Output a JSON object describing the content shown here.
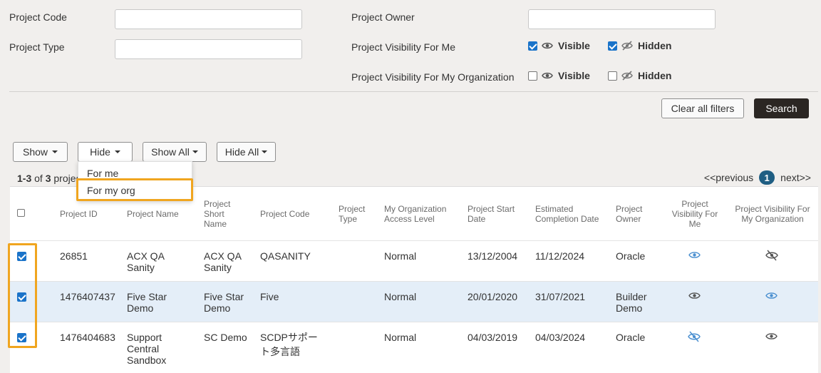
{
  "filters": {
    "project_code_label": "Project Code",
    "project_type_label": "Project Type",
    "project_owner_label": "Project Owner",
    "vis_me_label": "Project Visibility For Me",
    "vis_org_label": "Project Visibility For My Organization",
    "visible_label": "Visible",
    "hidden_label": "Hidden",
    "vis_me_visible_checked": true,
    "vis_me_hidden_checked": true,
    "vis_org_visible_checked": false,
    "vis_org_hidden_checked": false
  },
  "actions": {
    "clear_label": "Clear all filters",
    "search_label": "Search"
  },
  "toolbar": {
    "show_label": "Show",
    "hide_label": "Hide",
    "show_all_label": "Show All",
    "hide_all_label": "Hide All"
  },
  "hide_menu": {
    "items": [
      "For me",
      "For my org"
    ]
  },
  "results": {
    "range": "1-3",
    "of": "of",
    "total": "3",
    "suffix": "projects"
  },
  "pager": {
    "prev": "<<previous",
    "page": "1",
    "next": "next>>"
  },
  "table": {
    "headers": {
      "project_id": "Project ID",
      "project_name": "Project Name",
      "short_name": "Project Short Name",
      "project_code": "Project Code",
      "project_type": "Project Type",
      "org_access": "My Organization Access Level",
      "start_date": "Project Start Date",
      "completion_date": "Estimated Completion Date",
      "owner": "Project Owner",
      "vis_me": "Project Visibility For Me",
      "vis_org": "Project Visibility For My Organization"
    },
    "rows": [
      {
        "checked": true,
        "id": "26851",
        "name": "ACX QA Sanity",
        "short": "ACX QA Sanity",
        "code": "QASANITY",
        "type": "",
        "access": "Normal",
        "start": "13/12/2004",
        "end": "11/12/2024",
        "owner": "Oracle",
        "vis_me": "eye-icon",
        "vis_org": "eye-slash-icon"
      },
      {
        "checked": true,
        "id": "1476407437",
        "name": "Five Star Demo",
        "short": "Five Star Demo",
        "code": "Five",
        "type": "",
        "access": "Normal",
        "start": "20/01/2020",
        "end": "31/07/2021",
        "owner": "Builder Demo",
        "vis_me": "eye-icon",
        "vis_org": "eye-icon"
      },
      {
        "checked": true,
        "id": "1476404683",
        "name": "Support Central Sandbox",
        "short": "SC Demo",
        "code": "SCDPサポート多言語",
        "type": "",
        "access": "Normal",
        "start": "04/03/2019",
        "end": "04/03/2024",
        "owner": "Oracle",
        "vis_me": "eye-slash-icon",
        "vis_org": "eye-icon"
      }
    ]
  },
  "colors": {
    "accent_blue": "#1a73c9",
    "icon_blue": "#4a8fd0",
    "icon_gray": "#555555",
    "highlight": "#f0a51f",
    "selected_row": "#e4eef8",
    "search_button": "#2b2623"
  }
}
